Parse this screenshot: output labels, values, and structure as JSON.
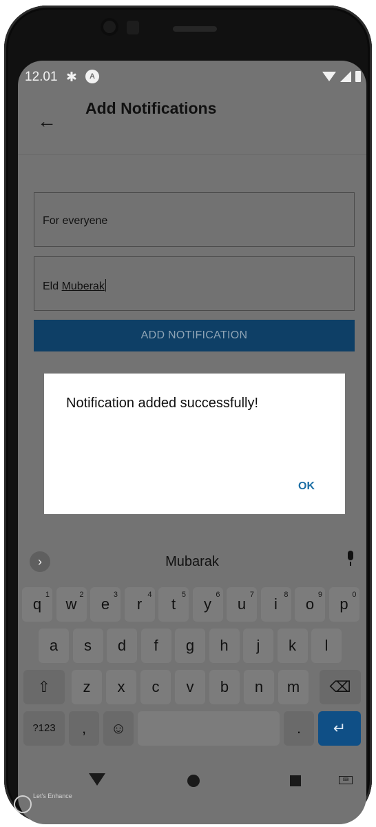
{
  "status_bar": {
    "time": "12.01"
  },
  "app_bar": {
    "back_icon": "arrow-back-icon",
    "title": "Add Notifications"
  },
  "form": {
    "recipient_value": "For everyene",
    "message_prefix": "Eld ",
    "message_underlined": "Muberak",
    "submit_label": "ADD NOTIFICATION"
  },
  "dialog": {
    "message": "Notification added successfully!",
    "ok_label": "OK"
  },
  "keyboard": {
    "suggestion": "Mubarak",
    "row1": [
      {
        "k": "q",
        "n": "1"
      },
      {
        "k": "w",
        "n": "2"
      },
      {
        "k": "e",
        "n": "3"
      },
      {
        "k": "r",
        "n": "4"
      },
      {
        "k": "t",
        "n": "5"
      },
      {
        "k": "y",
        "n": "6"
      },
      {
        "k": "u",
        "n": "7"
      },
      {
        "k": "i",
        "n": "8"
      },
      {
        "k": "o",
        "n": "9"
      },
      {
        "k": "p",
        "n": "0"
      }
    ],
    "row2": [
      "a",
      "s",
      "d",
      "f",
      "g",
      "h",
      "j",
      "k",
      "l"
    ],
    "row3": [
      "z",
      "x",
      "c",
      "v",
      "b",
      "n",
      "m"
    ],
    "symbols_label": "?123",
    "comma_label": ",",
    "period_label": ".",
    "emoji": "☺",
    "shift": "⇧",
    "backspace": "⌫",
    "enter": "↵"
  },
  "watermark": {
    "text": "Let's Enhance"
  },
  "colors": {
    "accent": "#0e3f66",
    "dialog_ok": "#1d6fa5",
    "scrim": "#737373"
  }
}
